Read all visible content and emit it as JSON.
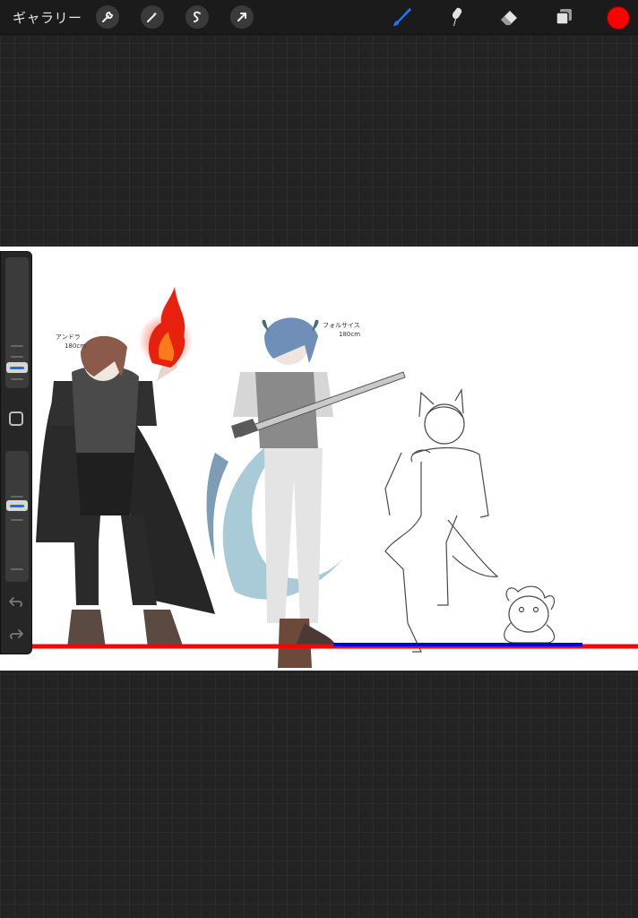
{
  "topbar": {
    "gallery_label": "ギャラリー",
    "left_tools": [
      "wrench-icon",
      "magic-wand-icon",
      "selection-icon",
      "transform-arrow-icon"
    ],
    "right_tools": [
      "brush-icon",
      "smudge-icon",
      "eraser-icon",
      "layers-icon"
    ],
    "active_tool": "brush-icon",
    "current_color": "#ff0000"
  },
  "canvas": {
    "annotations": [
      {
        "text": "アンドラ\n180cm"
      },
      {
        "text": "フォルサイス\n180cm"
      }
    ],
    "ground_line_color": "#ff0000",
    "second_line_color": "#0000dd"
  },
  "sidebar": {
    "brush_size": 0.79,
    "brush_opacity": 0.41,
    "icons": [
      "modify-square-icon",
      "undo-icon",
      "redo-icon"
    ]
  }
}
